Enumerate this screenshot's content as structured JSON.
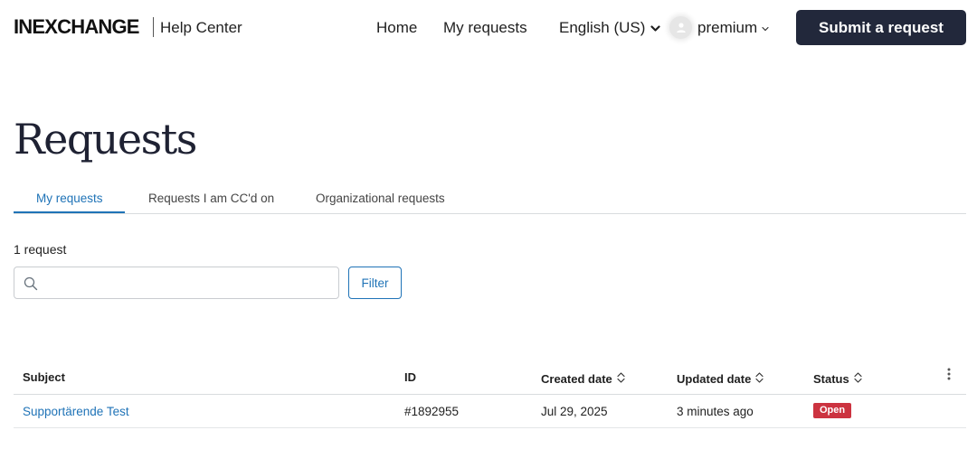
{
  "header": {
    "logo": "INEXCHANGE",
    "help_center": "Help Center",
    "nav": {
      "home": "Home",
      "my_requests": "My requests",
      "language": "English (US)"
    },
    "user_name": "premium",
    "submit_label": "Submit a request"
  },
  "page": {
    "title": "Requests",
    "tabs": [
      {
        "label": "My requests",
        "active": true
      },
      {
        "label": "Requests I am CC'd on",
        "active": false
      },
      {
        "label": "Organizational requests",
        "active": false
      }
    ],
    "count": "1 request",
    "search": {
      "placeholder": "",
      "value": ""
    },
    "filter_label": "Filter"
  },
  "table": {
    "columns": [
      {
        "label": "Subject",
        "sortable": false
      },
      {
        "label": "ID",
        "sortable": false
      },
      {
        "label": "Created date",
        "sortable": true
      },
      {
        "label": "Updated date",
        "sortable": true
      },
      {
        "label": "Status",
        "sortable": true
      }
    ],
    "rows": [
      {
        "subject": "Supportärende Test",
        "id": "#1892955",
        "created": "Jul 29, 2025",
        "updated": "3 minutes ago",
        "status": "Open"
      }
    ]
  },
  "colors": {
    "accent": "#1f73b7",
    "submit_bg": "#22283b",
    "status_open": "#cc3340"
  },
  "icons": [
    "chevron-down-icon",
    "user-avatar-icon",
    "search-icon",
    "sort-icon",
    "kebab-menu-icon"
  ]
}
